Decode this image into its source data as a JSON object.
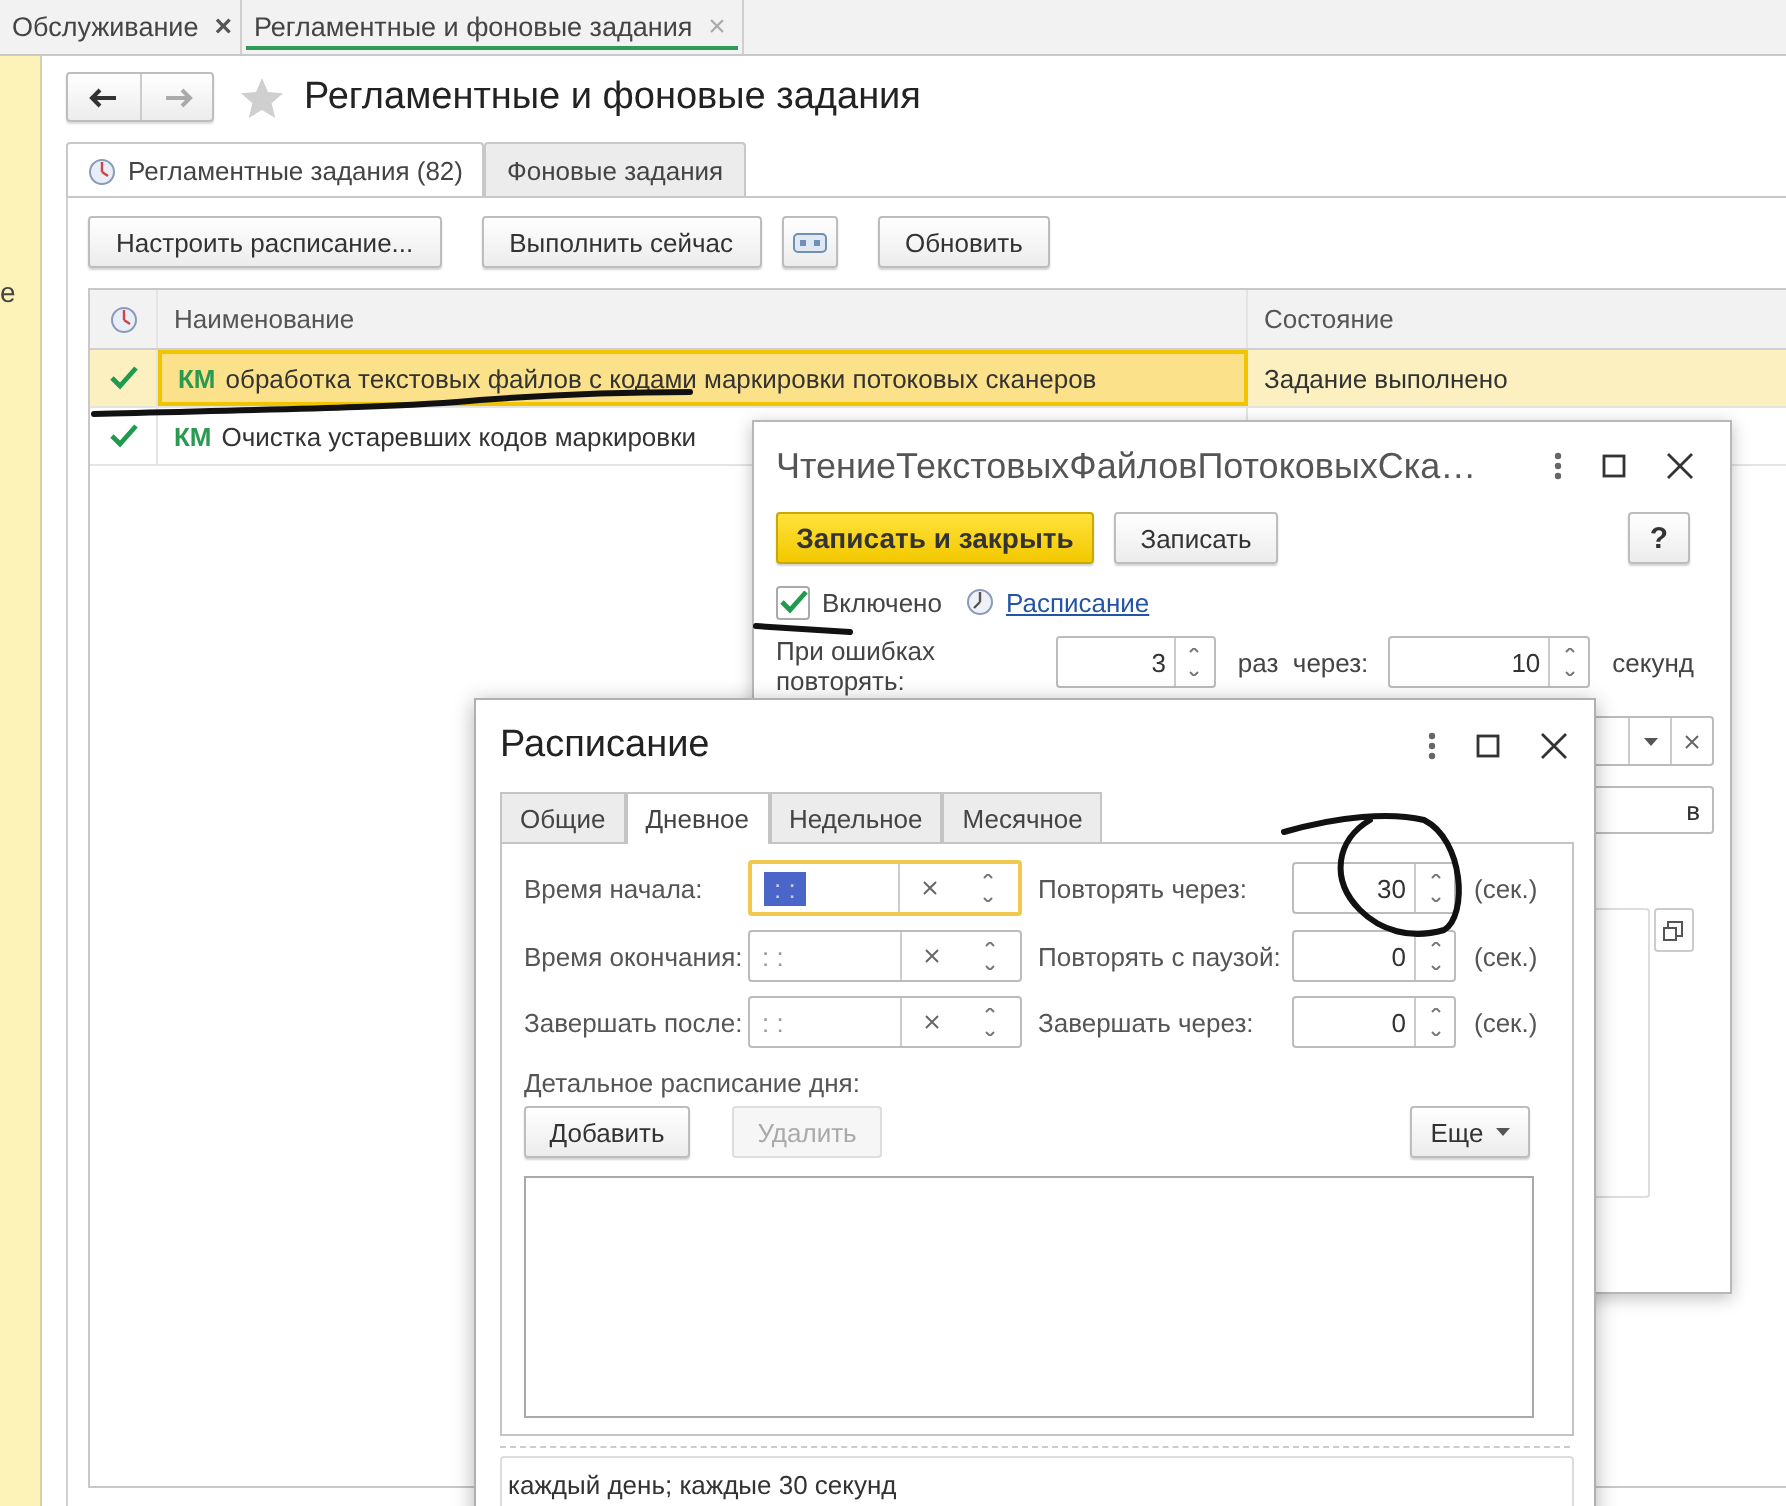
{
  "app_tabs": [
    {
      "label": "Обслуживание",
      "close": "×",
      "selected": false
    },
    {
      "label": "Регламентные и фоновые задания",
      "close": "×",
      "selected": true
    }
  ],
  "sidebar": {
    "text": "е"
  },
  "page": {
    "title": "Регламентные и фоновые задания"
  },
  "tabs": [
    {
      "label": "Регламентные задания (82)",
      "selected": true
    },
    {
      "label": "Фоновые задания",
      "selected": false
    }
  ],
  "toolbar": [
    {
      "kind": "text",
      "label": "Настроить расписание..."
    },
    {
      "kind": "text",
      "label": "Выполнить сейчас"
    },
    {
      "kind": "icon"
    },
    {
      "kind": "text",
      "label": "Обновить"
    }
  ],
  "table": {
    "columns": [
      "Наименование",
      "Состояние"
    ],
    "rows": [
      {
        "done": true,
        "prefix": "КМ",
        "name": "обработка текстовых файлов с кодами маркировки потоковых сканеров",
        "state": "Задание выполнено",
        "selected": true
      },
      {
        "done": true,
        "prefix": "КМ",
        "name": "Очистка устаревших кодов маркировки",
        "selected": false
      }
    ]
  },
  "task_dialog": {
    "title": "ЧтениеТекстовыхФайловПотоковыхСка…",
    "primary_button": "Записать и закрыть",
    "save_button": "Записать",
    "help_button": "?",
    "enabled": {
      "label": "Включено",
      "checked": true
    },
    "schedule_link": "Расписание",
    "retry": {
      "label": "При ошибках повторять:",
      "count": "3",
      "unit": "раз  через:",
      "interval": "10",
      "interval_unit": "секунд"
    },
    "partial_field": "в"
  },
  "schedule_dialog": {
    "title": "Расписание",
    "tabs": [
      {
        "label": "Общие",
        "selected": false
      },
      {
        "label": "Дневное",
        "selected": true
      },
      {
        "label": "Недельное",
        "selected": false
      },
      {
        "label": "Месячное",
        "selected": false
      }
    ],
    "rows": [
      {
        "label": "Время начала:",
        "value": ": :",
        "focused": true,
        "repeat_label": "Повторять через:",
        "repeat_value": "30",
        "unit": "(сек.)"
      },
      {
        "label": "Время окончания:",
        "value": ": :",
        "focused": false,
        "repeat_label": "Повторять с паузой:",
        "repeat_value": "0",
        "unit": "(сек.)"
      },
      {
        "label": "Завершать после:",
        "value": ": :",
        "focused": false,
        "repeat_label": "Завершать через:",
        "repeat_value": "0",
        "unit": "(сек.)"
      }
    ],
    "detail_label": "Детальное расписание дня:",
    "detail_buttons": [
      {
        "label": "Добавить",
        "disabled": false
      },
      {
        "label": "Удалить",
        "disabled": true
      }
    ],
    "more_button": "Еще",
    "summary": "каждый день; каждые 30 секунд"
  },
  "annotations": [
    {
      "kind": "underline"
    },
    {
      "kind": "underline"
    },
    {
      "kind": "circle"
    }
  ]
}
